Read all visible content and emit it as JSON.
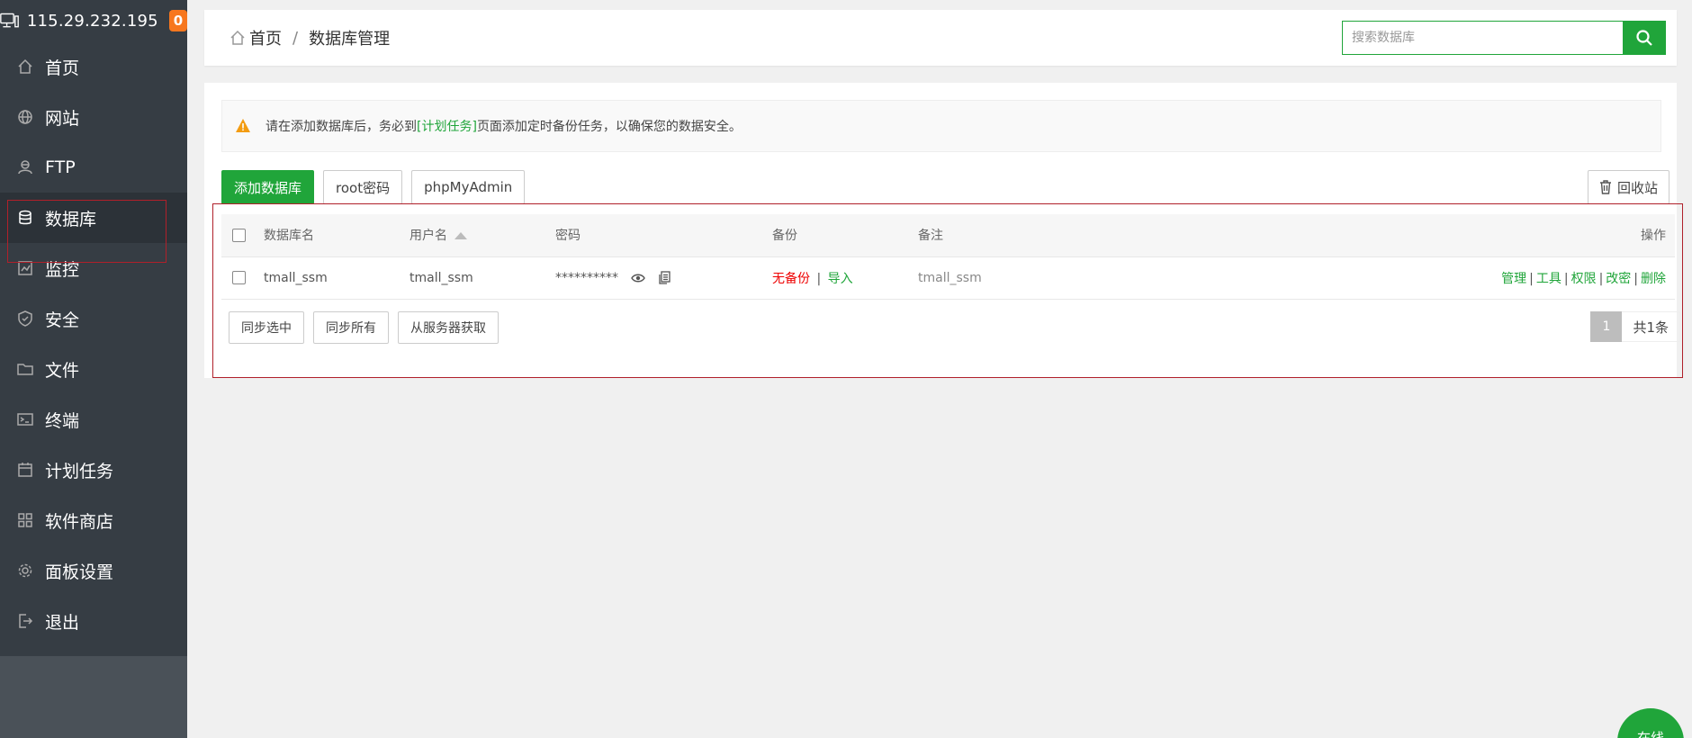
{
  "sidebar": {
    "ip": "115.29.232.195",
    "badge_count": "0",
    "items": [
      {
        "label": "首页",
        "icon": "home-icon"
      },
      {
        "label": "网站",
        "icon": "globe-icon"
      },
      {
        "label": "FTP",
        "icon": "ftp-icon"
      },
      {
        "label": "数据库",
        "icon": "database-icon",
        "active": true
      },
      {
        "label": "监控",
        "icon": "monitor-icon"
      },
      {
        "label": "安全",
        "icon": "shield-icon"
      },
      {
        "label": "文件",
        "icon": "folder-icon"
      },
      {
        "label": "终端",
        "icon": "terminal-icon"
      },
      {
        "label": "计划任务",
        "icon": "calendar-icon"
      },
      {
        "label": "软件商店",
        "icon": "apps-icon"
      },
      {
        "label": "面板设置",
        "icon": "gear-icon"
      },
      {
        "label": "退出",
        "icon": "logout-icon"
      }
    ]
  },
  "header": {
    "breadcrumb_home": "首页",
    "breadcrumb_sep": "/",
    "breadcrumb_current": "数据库管理",
    "search_placeholder": "搜索数据库"
  },
  "notice": {
    "prefix": "请在添加数据库后，务必到",
    "link": "[计划任务]",
    "suffix": "页面添加定时备份任务，以确保您的数据安全。"
  },
  "toolbar": {
    "add_label": "添加数据库",
    "root_label": "root密码",
    "phpmyadmin_label": "phpMyAdmin",
    "recycle_label": "回收站"
  },
  "table": {
    "headers": {
      "name": "数据库名",
      "user": "用户名",
      "password": "密码",
      "backup": "备份",
      "note": "备注",
      "ops": "操作"
    },
    "rows": [
      {
        "name": "tmall_ssm",
        "user": "tmall_ssm",
        "password": "**********",
        "backup_status": "无备份",
        "backup_sep": "|",
        "import_label": "导入",
        "note": "tmall_ssm",
        "ops": {
          "manage": "管理",
          "tools": "工具",
          "perm": "权限",
          "change_pwd": "改密",
          "delete": "删除",
          "sep": "|"
        }
      }
    ]
  },
  "footer": {
    "sync_selected": "同步选中",
    "sync_all": "同步所有",
    "fetch_from_server": "从服务器获取",
    "page": "1",
    "total": "共1条"
  },
  "float_button": {
    "label": "在线"
  },
  "colors": {
    "accent": "#20a53a",
    "sidebar_bg": "#363d44",
    "badge": "#f7771e",
    "danger": "#ee0000",
    "highlight_outline": "#b0202a"
  }
}
